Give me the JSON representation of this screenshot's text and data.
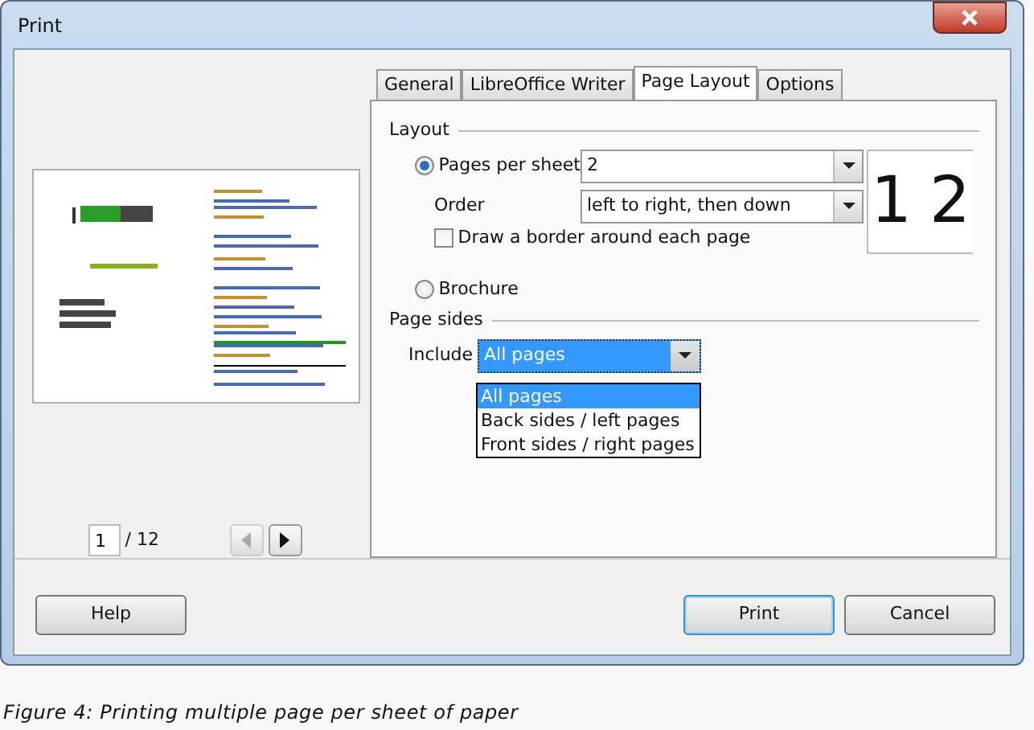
{
  "window": {
    "title": "Print"
  },
  "preview": {
    "page": "1",
    "total": "/ 12"
  },
  "tabs": [
    {
      "label": "General",
      "selected": false
    },
    {
      "label": "LibreOffice Writer",
      "selected": false
    },
    {
      "label": "Page Layout",
      "selected": true
    },
    {
      "label": "Options",
      "selected": false
    }
  ],
  "layout": {
    "heading": "Layout",
    "pages_per_sheet": {
      "label": "Pages per sheet",
      "selected": true,
      "value": "2"
    },
    "order": {
      "label": "Order",
      "value": "left to right, then down"
    },
    "border": {
      "label": "Draw a border around each page",
      "checked": false
    },
    "order_preview": [
      "1",
      "2"
    ],
    "brochure": {
      "label": "Brochure",
      "selected": false
    }
  },
  "page_sides": {
    "heading": "Page sides",
    "include": {
      "label": "Include",
      "value": "All pages",
      "options": [
        {
          "label": "All pages",
          "selected": true
        },
        {
          "label": "Back sides / left pages",
          "selected": false
        },
        {
          "label": "Front sides / right pages",
          "selected": false
        }
      ]
    }
  },
  "buttons": [
    {
      "label": "Help",
      "default": false
    },
    {
      "label": "Print",
      "default": true
    },
    {
      "label": "Cancel",
      "default": false
    }
  ],
  "caption": "Figure 4: Printing multiple page per sheet of paper"
}
